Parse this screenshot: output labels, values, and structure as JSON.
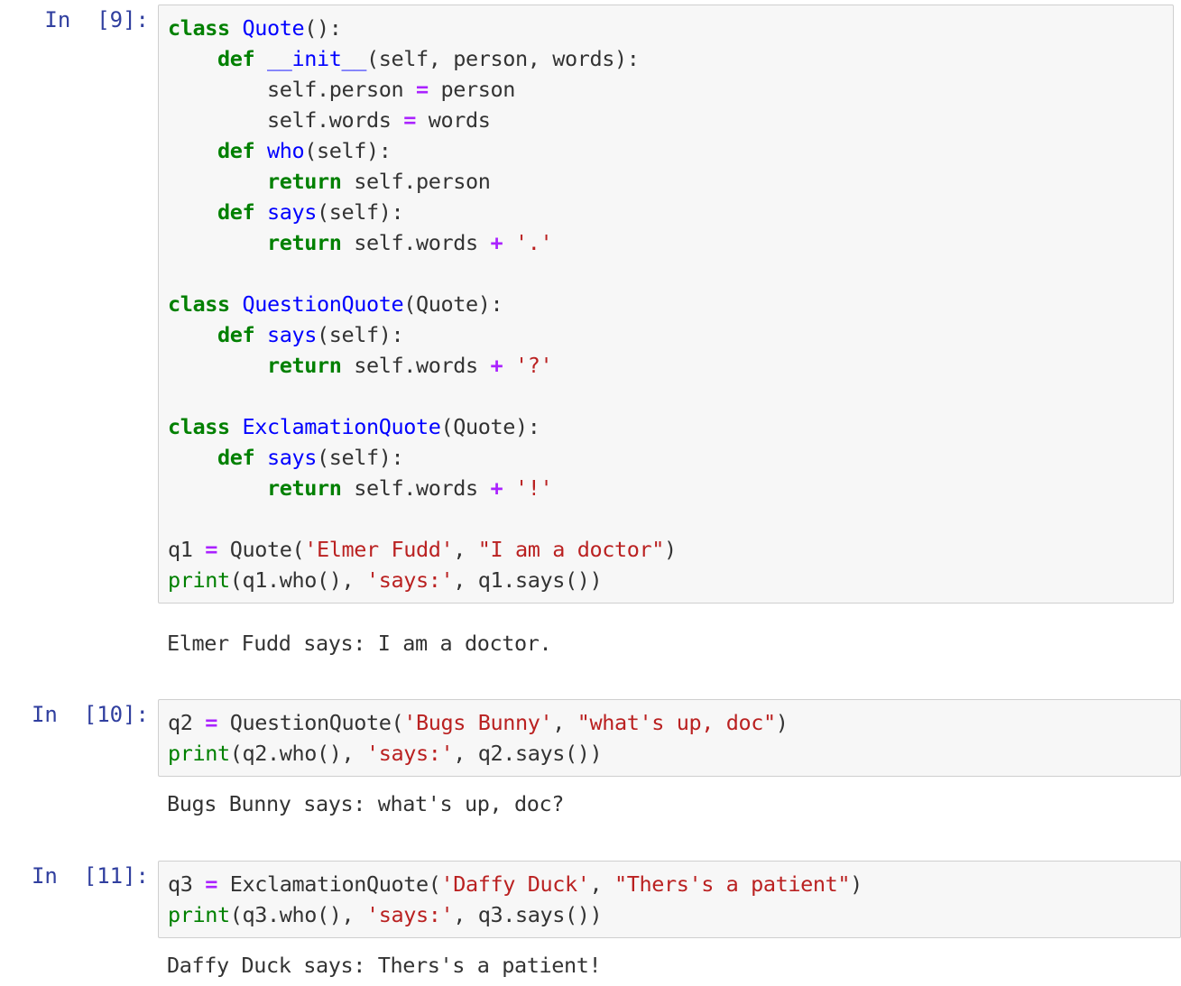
{
  "notebook": {
    "kernel_language": "python",
    "cells": [
      {
        "id": "cell-9",
        "type": "code",
        "prompt": "In  [9]:",
        "execution_count": 9,
        "source": "class Quote():\n    def __init__(self, person, words):\n        self.person = person\n        self.words = words\n    def who(self):\n        return self.person\n    def says(self):\n        return self.words + '.'\n\nclass QuestionQuote(Quote):\n    def says(self):\n        return self.words + '?'\n\nclass ExclamationQuote(Quote):\n    def says(self):\n        return self.words + '!'\n\nq1 = Quote('Elmer Fudd', \"I am a doctor\")\nprint(q1.who(), 'says:', q1.says())",
        "output": {
          "type": "stream",
          "text": "Elmer Fudd says: I am a doctor."
        }
      },
      {
        "id": "cell-10",
        "type": "code",
        "prompt": "In  [10]:",
        "execution_count": 10,
        "source": "q2 = QuestionQuote('Bugs Bunny', \"what's up, doc\")\nprint(q2.who(), 'says:', q2.says())",
        "output": {
          "type": "stream",
          "text": "Bugs Bunny says: what's up, doc?"
        }
      },
      {
        "id": "cell-11",
        "type": "code",
        "prompt": "In  [11]:",
        "execution_count": 11,
        "source": "q3 = ExclamationQuote('Daffy Duck', \"Thers's a patient\")\nprint(q3.who(), 'says:', q3.says())",
        "output": {
          "type": "stream",
          "text": "Daffy Duck says: Thers's a patient!"
        }
      }
    ]
  },
  "code_9": {
    "l1": {
      "kw": "class",
      "name": "Quote",
      "rest": "():"
    },
    "l2": {
      "indent": "    ",
      "kw": "def",
      "name": "__init__",
      "rest": "(self, person, words):"
    },
    "l3": {
      "indent": "        ",
      "lhs": "self.person ",
      "op": "=",
      "rhs": " person"
    },
    "l4": {
      "indent": "        ",
      "lhs": "self.words ",
      "op": "=",
      "rhs": " words"
    },
    "l5": {
      "indent": "    ",
      "kw": "def",
      "name": "who",
      "rest": "(self):"
    },
    "l6": {
      "indent": "        ",
      "kw": "return",
      "rest": " self.person"
    },
    "l7": {
      "indent": "    ",
      "kw": "def",
      "name": "says",
      "rest": "(self):"
    },
    "l8": {
      "indent": "        ",
      "kw": "return",
      "mid": " self.words ",
      "op": "+",
      "str": " '.'"
    },
    "l10": {
      "kw": "class",
      "name": "QuestionQuote",
      "rest": "(Quote):"
    },
    "l11": {
      "indent": "    ",
      "kw": "def",
      "name": "says",
      "rest": "(self):"
    },
    "l12": {
      "indent": "        ",
      "kw": "return",
      "mid": " self.words ",
      "op": "+",
      "str": " '?'"
    },
    "l14": {
      "kw": "class",
      "name": "ExclamationQuote",
      "rest": "(Quote):"
    },
    "l15": {
      "indent": "    ",
      "kw": "def",
      "name": "says",
      "rest": "(self):"
    },
    "l16": {
      "indent": "        ",
      "kw": "return",
      "mid": " self.words ",
      "op": "+",
      "str": " '!'"
    },
    "l18": {
      "var": "q1 ",
      "op": "=",
      "call": " Quote(",
      "str1": "'Elmer Fudd'",
      "comma": ", ",
      "str2": "\"I am a doctor\"",
      "close": ")"
    },
    "l19": {
      "fn": "print",
      "mid1": "(q1.who(), ",
      "str": "'says:'",
      "mid2": ", q1.says())"
    }
  },
  "code_10": {
    "l1": {
      "var": "q2 ",
      "op": "=",
      "call": " QuestionQuote(",
      "str1": "'Bugs Bunny'",
      "comma": ", ",
      "str2": "\"what's up, doc\"",
      "close": ")"
    },
    "l2": {
      "fn": "print",
      "mid1": "(q2.who(), ",
      "str": "'says:'",
      "mid2": ", q2.says())"
    }
  },
  "code_11": {
    "l1": {
      "var": "q3 ",
      "op": "=",
      "call": " ExclamationQuote(",
      "str1": "'Daffy Duck'",
      "comma": ", ",
      "str2": "\"Thers's a patient\"",
      "close": ")"
    },
    "l2": {
      "fn": "print",
      "mid1": "(q3.who(), ",
      "str": "'says:'",
      "mid2": ", q3.says())"
    }
  },
  "theme": {
    "page_background": "#ffffff",
    "cell_background": "#f7f7f7",
    "cell_border": "#cfcfcf",
    "prompt_color": "#303F9F",
    "keyword_color": "#008000",
    "name_color": "#0000FF",
    "builtin_color": "#008000",
    "string_color": "#BA2121",
    "operator_color": "#AA22FF",
    "text_color": "#333333"
  }
}
